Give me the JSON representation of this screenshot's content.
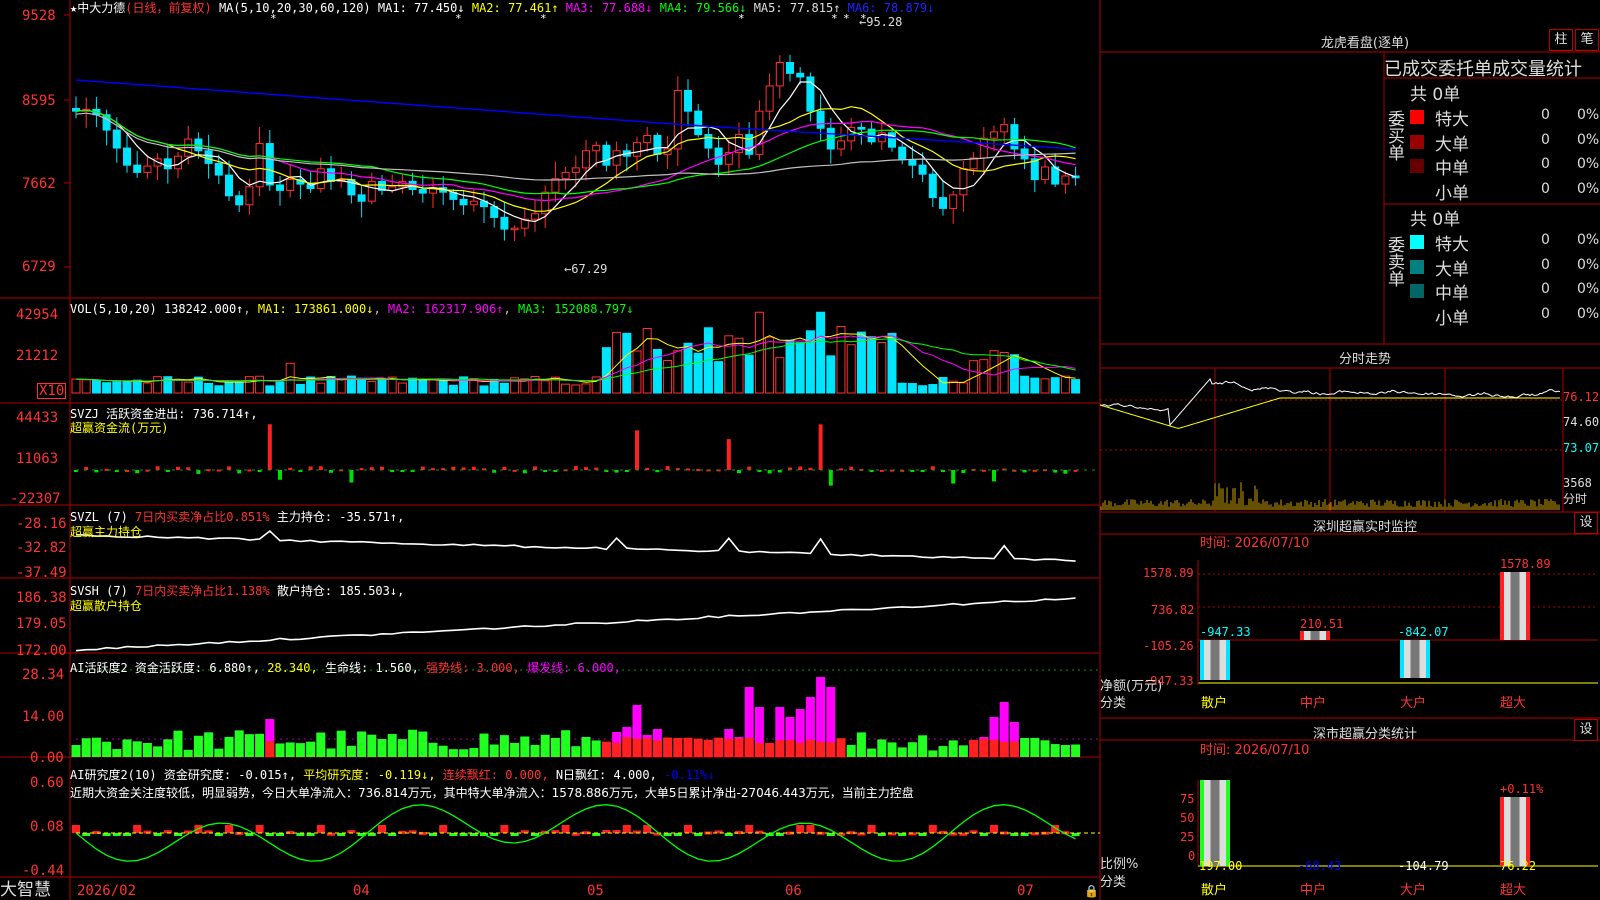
{
  "stock": {
    "name": "中大力德",
    "period": "(日线，前复权)"
  },
  "main_legend": {
    "ma_prefix": "MA(5,10,20,30,60,120)",
    "items": [
      {
        "label": "MA1:",
        "value": "77.450↓",
        "color": "#ffffff"
      },
      {
        "label": "MA2:",
        "value": "77.461↑",
        "color": "#ffff00"
      },
      {
        "label": "MA3:",
        "value": "77.688↓",
        "color": "#ff00ff"
      },
      {
        "label": "MA4:",
        "value": "79.566↓",
        "color": "#00ff00"
      },
      {
        "label": "MA5:",
        "value": "77.815↑",
        "color": "#c0c0c0"
      },
      {
        "label": "MA6:",
        "value": "78.879↓",
        "color": "#0000ff"
      }
    ],
    "high_mark": "95.28",
    "low_mark": "67.29"
  },
  "price_axis": [
    "9528",
    "8595",
    "7662",
    "6729"
  ],
  "vol_panel": {
    "legend_prefix": "VOL(5,10,20)",
    "value": "138242.000↑",
    "ma1": "MA1: 173861.000↓",
    "ma2": "MA2: 162317.906↑",
    "ma3": "MA3: 152088.797↓",
    "axis": [
      "42954",
      "21212",
      "X10"
    ]
  },
  "svzj_panel": {
    "legend": "SVZJ  活跃资金进出: 736.714↑,",
    "subtitle": "超赢资金流(万元)",
    "axis": [
      "44433",
      "11063",
      "-22307"
    ]
  },
  "svzl_panel": {
    "legend_a": "SVZL (7)",
    "legend_b": "7日内买卖净占比0.851%",
    "legend_c": "主力持仓: -35.571↑,",
    "subtitle": "超赢主力持仓",
    "axis": [
      "-28.16",
      "-32.82",
      "-37.49"
    ]
  },
  "svsh_panel": {
    "legend_a": "SVSH (7)",
    "legend_b": "7日内买卖净占比1.138%",
    "legend_c": "散户持仓: 185.503↓,",
    "subtitle": "超赢散户持仓",
    "axis": [
      "186.38",
      "179.05",
      "172.00"
    ]
  },
  "ai2_panel": {
    "a": "AI活跃度2",
    "b": "资金活跃度: 6.880↑,",
    "c": "28.340,",
    "d": "生命线: 1.560,",
    "e": "强势线: 3.000,",
    "f": "爆发线: 6.000,",
    "axis": [
      "28.34",
      "14.00",
      "0.00"
    ]
  },
  "ai_research": {
    "a": "AI研究度2(10)",
    "b": "资金研究度: -0.015↑,",
    "c": "平均研究度: -0.119↓,",
    "d": "连续飘红: 0.000,",
    "e": "N日飘红: 4.000,",
    "f": "-0.11%↓",
    "commentary": "近期大资金关注度较低，明显弱势，今日大单净流入：736.814万元，其中特大单净流入：1578.886万元，大单5日累计净出-27046.443万元，当前主力控盘",
    "axis": [
      "0.60",
      "0.08",
      "-0.44"
    ]
  },
  "date_axis": [
    "2026/02",
    "04",
    "05",
    "06",
    "07"
  ],
  "logo": "大智慧",
  "right": {
    "lhb_title": "龙虎看盘(逐单)",
    "btn_zhu": "柱",
    "btn_bi": "笔",
    "order_header": "已成交委托单成交量统计",
    "buy_label": "委买单",
    "sell_label": "委卖单",
    "buy_total": "共 0单",
    "sell_total": "共 0单",
    "buy_rows": [
      {
        "name": "特大",
        "count": "0",
        "pct": "0%",
        "color": "#ff0000"
      },
      {
        "name": "大单",
        "count": "0",
        "pct": "0%",
        "color": "#990000"
      },
      {
        "name": "中单",
        "count": "0",
        "pct": "0%",
        "color": "#660000"
      },
      {
        "name": "小单",
        "count": "0",
        "pct": "0%",
        "color": "#000000"
      }
    ],
    "sell_rows": [
      {
        "name": "特大",
        "count": "0",
        "pct": "0%",
        "color": "#00ffff"
      },
      {
        "name": "大单",
        "count": "0",
        "pct": "0%",
        "color": "#008080"
      },
      {
        "name": "中单",
        "count": "0",
        "pct": "0%",
        "color": "#006666"
      },
      {
        "name": "小单",
        "count": "0",
        "pct": "0%",
        "color": "#000000"
      }
    ],
    "intraday_title": "分时走势",
    "intraday_axis": [
      "76.12",
      "74.60",
      "73.07",
      "3568",
      "分时"
    ],
    "sz_title": "深圳超赢实时监控",
    "sz_time": "时间: 2026/07/10",
    "sz_axis": [
      "1578.89",
      "736.82",
      "-105.26",
      "-947.33"
    ],
    "sz_values": [
      "-947.33",
      "210.51",
      "-842.07",
      "1578.89"
    ],
    "sz_top": "1578.89",
    "sz_ylabel": "净额(万元)",
    "sz_xlabel": "分类",
    "categories": [
      "散户",
      "中户",
      "大户",
      "超大"
    ],
    "set_label": "设",
    "stat_title": "深市超赢分类统计",
    "stat_time": "时间: 2026/07/10",
    "stat_axis": [
      "75",
      "50",
      "25",
      "0"
    ],
    "stat_top": "+0.11%",
    "stat_values": [
      "197.00",
      "-68.43",
      "-104.79",
      "76.22"
    ],
    "stat_ylabel": "比例%",
    "stat_xlabel": "分类"
  }
}
